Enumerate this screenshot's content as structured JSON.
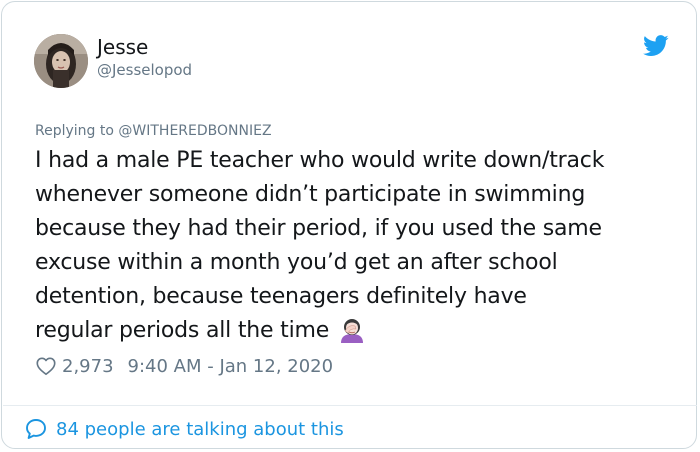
{
  "author": {
    "display_name": "Jesse",
    "handle": "@Jesselopod"
  },
  "reply": {
    "prefix": "Replying to ",
    "handle": "@WITHEREDBONNIEZ"
  },
  "tweet": {
    "lines": [
      "I had a male PE teacher who would write down/track",
      "whenever someone didn’t participate in swimming",
      "because they had their period, if you used the same",
      "excuse within a month you’d get an after school",
      "detention, because teenagers definitely have",
      "regular periods all the time"
    ],
    "emoji": "woman-facepalming-emoji"
  },
  "meta": {
    "likes": "2,973",
    "timestamp": "9:40 AM - Jan 12, 2020"
  },
  "footer": {
    "talking_text": "84 people are talking about this"
  },
  "icons": {
    "brand": "twitter-bird-icon",
    "like": "heart-icon",
    "conversation": "speech-bubble-icon"
  },
  "colors": {
    "twitter_blue": "#1da1f2",
    "link_blue": "#1b95e0",
    "secondary_text": "#657786",
    "primary_text": "#14171a"
  }
}
